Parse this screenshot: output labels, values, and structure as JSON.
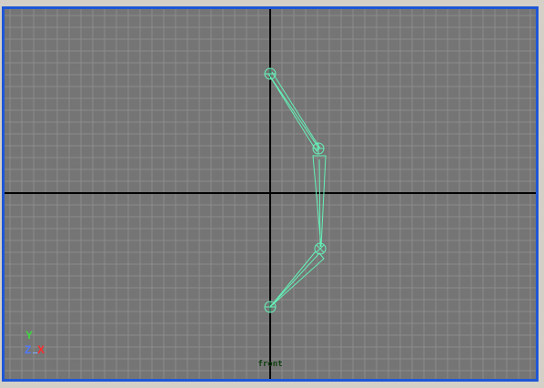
{
  "viewport": {
    "camera_label": "front",
    "axis_indicator": {
      "y": "Y",
      "z": "Z",
      "x": "X"
    },
    "colors": {
      "frame": "#1f57d6",
      "background": "#757575",
      "grid_line": "#8a8a8a",
      "axis_line": "#000000",
      "bone": "#62f0b6",
      "camera_label": "#0f3f0f"
    }
  },
  "skeleton": {
    "joint_count": 4,
    "bone_count": 3
  }
}
